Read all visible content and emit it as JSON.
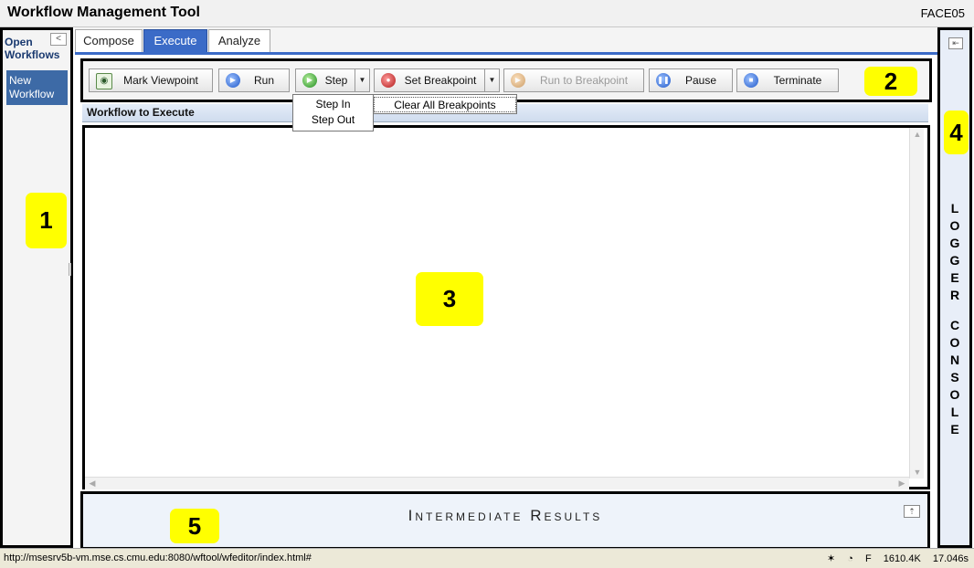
{
  "app": {
    "title": "Workflow Management Tool",
    "user_id": "FACE05"
  },
  "sidebar": {
    "header": "Open Workflows",
    "collapse_glyph": "<",
    "items": [
      {
        "label": "New Workflow"
      }
    ]
  },
  "tabs": [
    {
      "label": "Compose",
      "active": false
    },
    {
      "label": "Execute",
      "active": true
    },
    {
      "label": "Analyze",
      "active": false
    }
  ],
  "toolbar": {
    "mark_viewpoint": {
      "label": "Mark Viewpoint",
      "icon": "eye-icon"
    },
    "run": {
      "label": "Run",
      "icon": "play-icon"
    },
    "step": {
      "label": "Step",
      "icon": "step-icon"
    },
    "set_breakpoint": {
      "label": "Set Breakpoint",
      "icon": "breakpoint-icon"
    },
    "run_to_breakpoint": {
      "label": "Run to Breakpoint",
      "icon": "play-icon",
      "disabled": true
    },
    "pause": {
      "label": "Pause",
      "icon": "pause-icon"
    },
    "terminate": {
      "label": "Terminate",
      "icon": "stop-icon"
    }
  },
  "step_menu": {
    "items": [
      "Step In",
      "Step Out"
    ]
  },
  "breakpoint_menu": {
    "items": [
      "Clear All Breakpoints"
    ]
  },
  "workflow_section": {
    "title": "Workflow to Execute"
  },
  "logger": {
    "line1": "LOGGER",
    "line2": "CONSOLE"
  },
  "results": {
    "title": "Intermediate Results"
  },
  "callouts": [
    "1",
    "2",
    "3",
    "4",
    "5"
  ],
  "status": {
    "url": "http://msesrv5b-vm.mse.cs.cmu.edu:8080/wftool/wfeditor/index.html#",
    "indicator": "F",
    "memory": "1610.4K",
    "time": "17.046s"
  },
  "colors": {
    "accent": "#3b6bc7",
    "callout": "#ffff00",
    "sidebar_item": "#3d6aa6"
  }
}
